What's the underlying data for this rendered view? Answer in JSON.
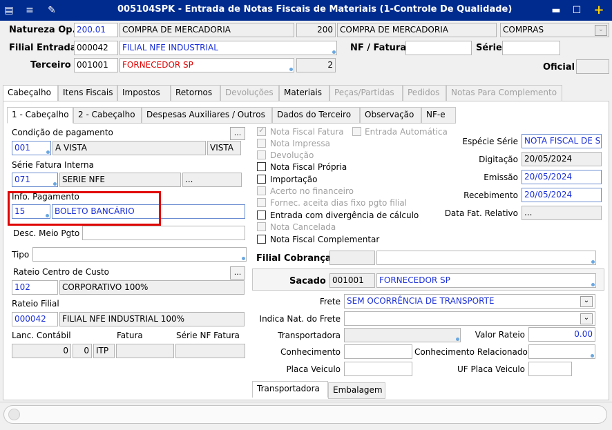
{
  "window": {
    "title": "005104SPK - Entrada de Notas Fiscais de Materiais (1-Controle De Qualidade)"
  },
  "header": {
    "natureza_label": "Natureza Op.",
    "natureza_code": "200.01",
    "natureza_desc": "COMPRA DE MERCADORIA",
    "natureza_num": "200",
    "natureza_desc2": "COMPRA DE MERCADORIA",
    "natureza_type": "COMPRAS",
    "filial_label": "Filial Entrada",
    "filial_code": "000042",
    "filial_name": "FILIAL NFE INDUSTRIAL",
    "nf_label": "NF / Fatura",
    "nf_value": "",
    "serie_label": "Série",
    "serie_value": "",
    "terceiro_label": "Terceiro",
    "terceiro_code": "001001",
    "terceiro_name": "FORNECEDOR SP",
    "terceiro_num": "2",
    "oficial_label": "Oficial",
    "oficial_value": ""
  },
  "main_tabs": [
    {
      "label": "Cabeçalho"
    },
    {
      "label": "Itens Fiscais"
    },
    {
      "label": "Impostos"
    },
    {
      "label": "Retornos"
    },
    {
      "label": "Devoluções"
    },
    {
      "label": "Materiais"
    },
    {
      "label": "Peças/Partidas"
    },
    {
      "label": "Pedidos"
    },
    {
      "label": "Notas Para Complemento"
    }
  ],
  "sub_tabs": [
    {
      "label": "1 - Cabeçalho"
    },
    {
      "label": "2 - Cabeçalho"
    },
    {
      "label": "Despesas Auxiliares / Outros"
    },
    {
      "label": "Dados do Terceiro"
    },
    {
      "label": "Observação"
    },
    {
      "label": "NF-e"
    }
  ],
  "left": {
    "cond_label": "Condição de pagamento",
    "cond_code": "001",
    "cond_desc": "A VISTA",
    "cond_short": "VISTA",
    "ellipsis": "...",
    "serie_label": "Série Fatura Interna",
    "serie_code": "071",
    "serie_desc": "SERIE NFE",
    "info_label": "Info. Pagamento",
    "info_code": "15",
    "info_desc": "BOLETO BANCÁRIO",
    "desc_meio_label": "Desc. Meio Pgto",
    "tipo_label": "Tipo",
    "rateio_cc_label": "Rateio Centro de Custo",
    "rateio_cc_code": "102",
    "rateio_cc_desc": "CORPORATIVO 100%",
    "rateio_filial_label": "Rateio Filial",
    "rateio_filial_code": "000042",
    "rateio_filial_desc": "FILIAL NFE INDUSTRIAL 100%",
    "lanc_label": "Lanc. Contábil",
    "fatura_label": "Fatura",
    "serie_nf_label": "Série NF Fatura",
    "lanc_v1": "0",
    "lanc_v2": "0",
    "lanc_v3": "ITP"
  },
  "checks": {
    "nota_fatura": "Nota Fiscal Fatura",
    "entrada_auto": "Entrada Automática",
    "nota_impressa": "Nota Impressa",
    "devolucao": "Devolução",
    "nota_propria": "Nota Fiscal Própria",
    "importacao": "Importação",
    "acerto": "Acerto no financeiro",
    "fornec": "Fornec. aceita dias fixo pgto filial",
    "divergencia": "Entrada com divergência de cálculo",
    "cancelada": "Nota Cancelada",
    "complementar": "Nota Fiscal Complementar"
  },
  "right": {
    "especie_label": "Espécie Série",
    "especie_value": "NOTA FISCAL DE S",
    "digitacao_label": "Digitação",
    "digitacao_value": "20/05/2024",
    "emissao_label": "Emissão",
    "emissao_value": "20/05/2024",
    "recebimento_label": "Recebimento",
    "recebimento_value": "20/05/2024",
    "data_fat_label": "Data Fat. Relativo",
    "data_fat_value": "...",
    "filial_cobr_label": "Filial Cobrança",
    "sacado_label": "Sacado",
    "sacado_code": "001001",
    "sacado_name": "FORNECEDOR SP",
    "frete_label": "Frete",
    "frete_value": "SEM OCORRÊNCIA DE TRANSPORTE",
    "indica_label": "Indica Nat. do Frete",
    "transportadora_label": "Transportadora",
    "valor_rateio_label": "Valor Rateio",
    "valor_rateio_value": "0.00",
    "conhecimento_label": "Conhecimento",
    "conh_rel_label": "Conhecimento Relacionado",
    "placa_label": "Placa Veiculo",
    "uf_placa_label": "UF Placa Veiculo",
    "bottom_tab1": "Transportadora",
    "bottom_tab2": "Embalagem"
  }
}
